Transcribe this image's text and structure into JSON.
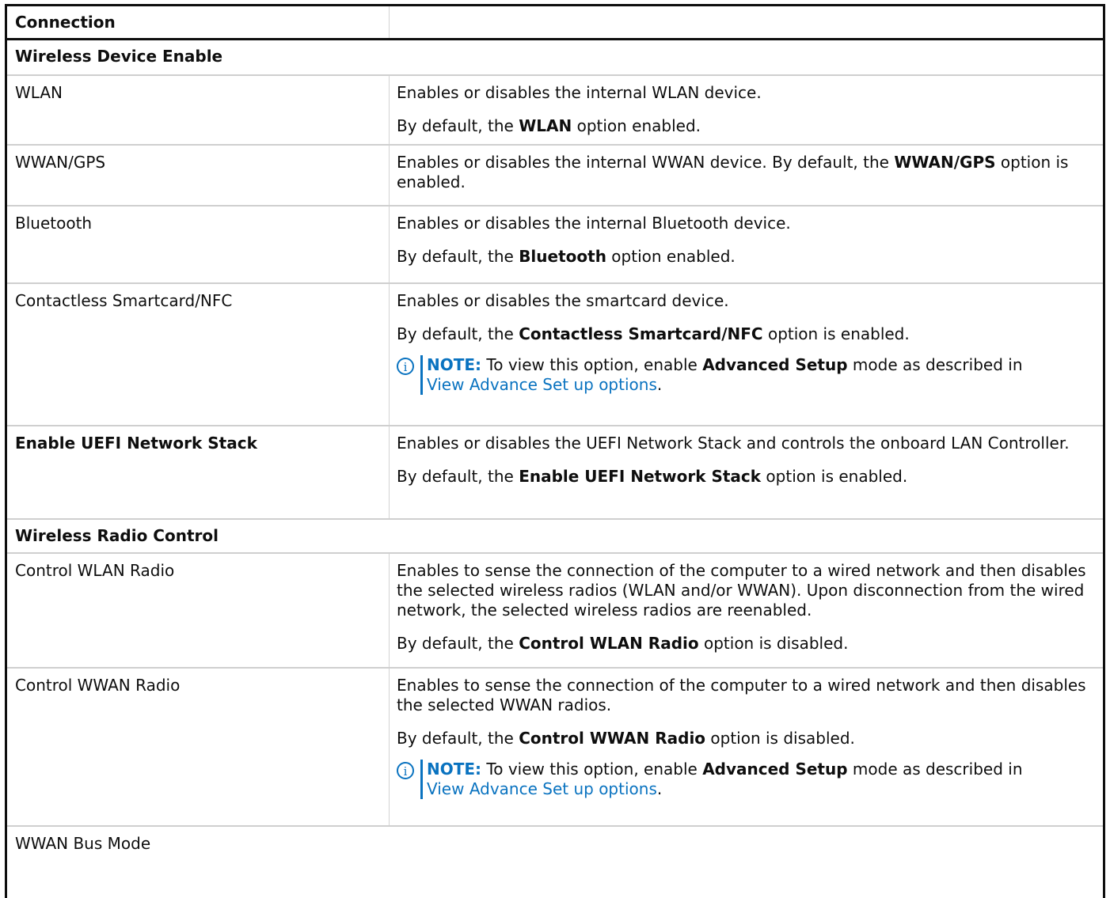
{
  "header": {
    "title": "Connection"
  },
  "sections": {
    "wireless_device_enable": "Wireless Device Enable",
    "wireless_radio_control": "Wireless Radio Control"
  },
  "rows": {
    "wlan": {
      "name": "WLAN",
      "desc": "Enables or disables the internal WLAN device.",
      "default_pre": "By default, the ",
      "default_bold": "WLAN",
      "default_post": " option enabled."
    },
    "wwan_gps": {
      "name": "WWAN/GPS",
      "desc_pre": "Enables or disables the internal WWAN device. By default, the ",
      "desc_bold": "WWAN/GPS",
      "desc_post": " option is enabled."
    },
    "bluetooth": {
      "name": "Bluetooth",
      "desc": "Enables or disables the internal Bluetooth device.",
      "default_pre": "By default, the ",
      "default_bold": "Bluetooth",
      "default_post": " option enabled."
    },
    "nfc": {
      "name": "Contactless Smartcard/NFC",
      "desc": "Enables or disables the smartcard device.",
      "default_pre": "By default, the ",
      "default_bold": "Contactless Smartcard/NFC",
      "default_post": " option is enabled."
    },
    "uefi_stack": {
      "name": "Enable UEFI Network Stack",
      "desc": "Enables or disables the UEFI Network Stack and controls the onboard LAN Controller.",
      "default_pre": "By default, the ",
      "default_bold": "Enable UEFI Network Stack",
      "default_post": " option is enabled."
    },
    "control_wlan": {
      "name": "Control WLAN Radio",
      "desc": "Enables to sense the connection of the computer to a wired network and then disables the selected wireless radios (WLAN and/or WWAN). Upon disconnection from the wired network, the selected wireless radios are reenabled.",
      "default_pre": "By default, the ",
      "default_bold": "Control WLAN Radio",
      "default_post": " option is disabled."
    },
    "control_wwan": {
      "name": "Control WWAN Radio",
      "desc": "Enables to sense the connection of the computer to a wired network and then disables the selected WWAN radios.",
      "default_pre": "By default, the ",
      "default_bold": "Control WWAN Radio",
      "default_post": " option is disabled."
    },
    "wwan_bus": {
      "name": "WWAN Bus Mode"
    }
  },
  "note": {
    "icon": "i",
    "label": "NOTE:",
    "pre": " To view this option, enable ",
    "bold": "Advanced Setup",
    "post": " mode as described in ",
    "link": "View Advance Set up options",
    "end": "."
  }
}
